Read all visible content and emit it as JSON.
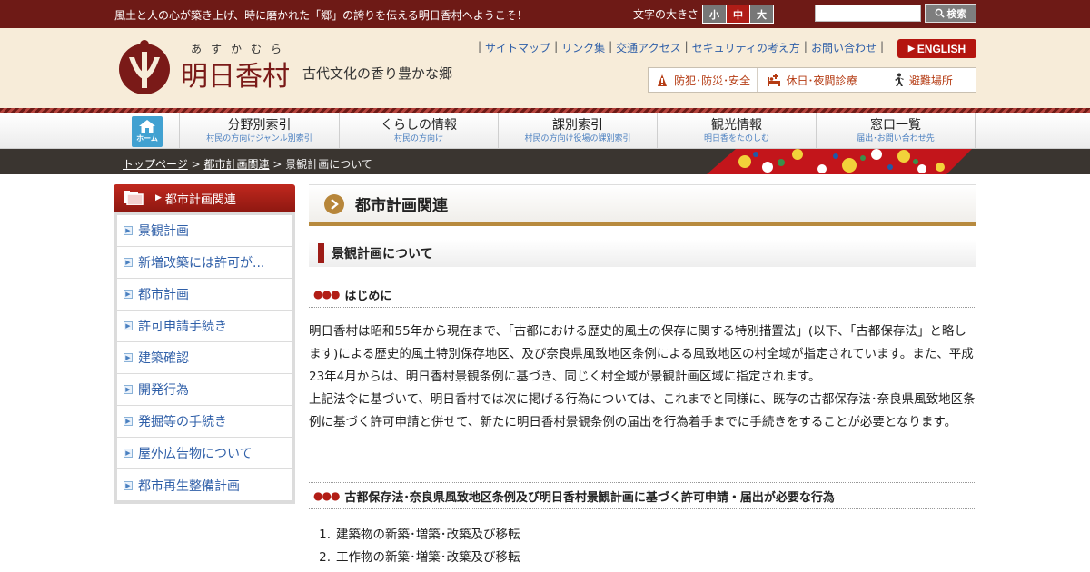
{
  "topbar": {
    "welcome": "風土と人の心が築き上げ、時に磨かれた「郷」の誇りを伝える明日香村へようこそ！",
    "font_size_label": "文字の大きさ",
    "font_sizes": [
      "小",
      "中",
      "大"
    ],
    "font_size_selected": "中",
    "search_placeholder": "",
    "search_button": "検索"
  },
  "header": {
    "logo_ruby": "あすかむら",
    "logo_name": "明日香村",
    "tagline": "古代文化の香り豊かな郷",
    "util_links": [
      "サイトマップ",
      "リンク集",
      "交通アクセス",
      "セキュリティの考え方",
      "お問い合わせ"
    ],
    "english": "ENGLISH",
    "quick_links": [
      {
        "label": "防犯･防災･安全",
        "icon": "safety-icon"
      },
      {
        "label": "休日･夜間診療",
        "icon": "medical-bed-icon"
      },
      {
        "label": "避難場所",
        "icon": "running-person-icon"
      }
    ],
    "colors": {
      "brand": "#6e1a16",
      "accent": "#b4150f",
      "link": "#2f5fa8"
    }
  },
  "gnav": {
    "home": "ホーム",
    "items": [
      {
        "main": "分野別索引",
        "sub": "村民の方向けジャンル別索引"
      },
      {
        "main": "くらしの情報",
        "sub": "村民の方向け"
      },
      {
        "main": "課別索引",
        "sub": "村民の方向け役場の課別索引"
      },
      {
        "main": "観光情報",
        "sub": "明日香をたのしむ"
      },
      {
        "main": "窓口一覧",
        "sub": "届出･お問い合わせ先"
      }
    ]
  },
  "breadcrumb": {
    "items": [
      "トップページ",
      "都市計画関連"
    ],
    "current": "景観計画について",
    "sep": ">"
  },
  "sidebar": {
    "title": "都市計画関連",
    "items": [
      "景観計画",
      "新増改築には許可が...",
      "都市計画",
      "許可申請手続き",
      "建築確認",
      "開発行為",
      "発掘等の手続き",
      "屋外広告物について",
      "都市再生整備計画"
    ]
  },
  "main": {
    "title": "都市計画関連",
    "subtitle": "景観計画について",
    "section1": {
      "title": "はじめに",
      "paragraphs": [
        "明日香村は昭和55年から現在まで、「古都における歴史的風土の保存に関する特別措置法」(以下、「古都保存法」と略します)による歴史的風土特別保存地区、及び奈良県風致地区条例による風致地区の村全域が指定されています。また、平成23年4月からは、明日香村景観条例に基づき、同じく村全域が景観計画区域に指定されます。",
        "上記法令に基づいて、明日香村では次に掲げる行為については、これまでと同様に、既存の古都保存法･奈良県風致地区条例に基づく許可申請と併せて、新たに明日香村景観条例の届出を行為着手までに手続きをすることが必要となります。"
      ]
    },
    "section2": {
      "title": "古都保存法･奈良県風致地区条例及び明日香村景観計画に基づく許可申請・届出が必要な行為",
      "list": [
        "建築物の新築･増築･改築及び移転",
        "工作物の新築･増築･改築及び移転"
      ]
    },
    "section_marker": "●●●"
  }
}
